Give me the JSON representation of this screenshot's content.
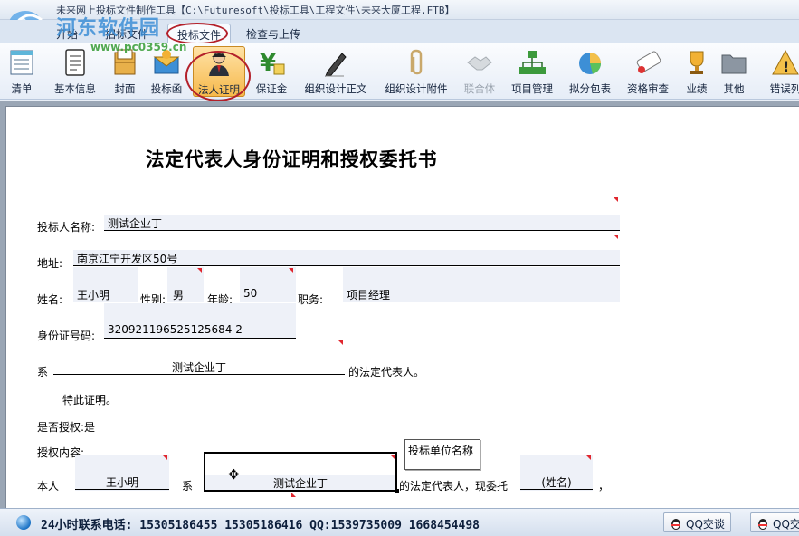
{
  "window": {
    "title": "未来网上投标文件制作工具【C:\\Futuresoft\\投标工具\\工程文件\\未来大厦工程.FTB】",
    "watermark": "河东软件园",
    "watermark_url": "www.pc0359.cn"
  },
  "tabs": [
    {
      "label": "开始"
    },
    {
      "label": "招标文件"
    },
    {
      "label": "投标文件"
    },
    {
      "label": "检查与上传"
    }
  ],
  "toolbar": [
    {
      "label": "清单",
      "icon": "list-icon"
    },
    {
      "label": "基本信息",
      "icon": "document-icon"
    },
    {
      "label": "封面",
      "icon": "cover-icon"
    },
    {
      "label": "投标函",
      "icon": "letter-icon"
    },
    {
      "label": "法人证明",
      "icon": "person-icon"
    },
    {
      "label": "保证金",
      "icon": "yen-icon"
    },
    {
      "label": "组织设计正文",
      "icon": "pen-icon"
    },
    {
      "label": "组织设计附件",
      "icon": "paperclip-icon"
    },
    {
      "label": "联合体",
      "icon": "handshake-icon"
    },
    {
      "label": "项目管理",
      "icon": "org-chart-icon"
    },
    {
      "label": "拟分包表",
      "icon": "pie-chart-icon"
    },
    {
      "label": "资格审查",
      "icon": "certificate-icon"
    },
    {
      "label": "业绩",
      "icon": "trophy-icon"
    },
    {
      "label": "其他",
      "icon": "folder-icon"
    },
    {
      "label": "错误列",
      "icon": "warning-icon"
    }
  ],
  "document": {
    "title": "法定代表人身份证明和授权委托书",
    "bidder_label": "投标人名称:",
    "bidder_value": "测试企业丁",
    "address_label": "地址:",
    "address_value": "南京江宁开发区50号",
    "name_label": "姓名:",
    "name_value": "王小明",
    "gender_label": "性别:",
    "gender_value": "男",
    "age_label": "年龄:",
    "age_value": "50",
    "position_label": "职务:",
    "position_value": "项目经理",
    "id_label": "身份证号码:",
    "id_value": "320921196525125684 2",
    "xi_label": "系",
    "xi_value": "测试企业丁",
    "legal_rep_suffix": "的法定代表人。",
    "hereby_proven": "特此证明。",
    "authorized_text": "是否授权:是",
    "auth_content_label": "授权内容:",
    "principal_label": "本人",
    "principal_value": "王小明",
    "xi2_label": "系",
    "company2_value": "测试企业丁",
    "entrust_text": "的法定代表人，现委托",
    "agent_placeholder": "(姓名)",
    "comma": "，",
    "tooltip": "投标单位名称"
  },
  "statusbar": {
    "text": "24小时联系电话: 15305186455 15305186416   QQ:1539735009 1668454498",
    "qq_buttons": [
      "QQ交谈",
      "QQ交谈"
    ]
  }
}
